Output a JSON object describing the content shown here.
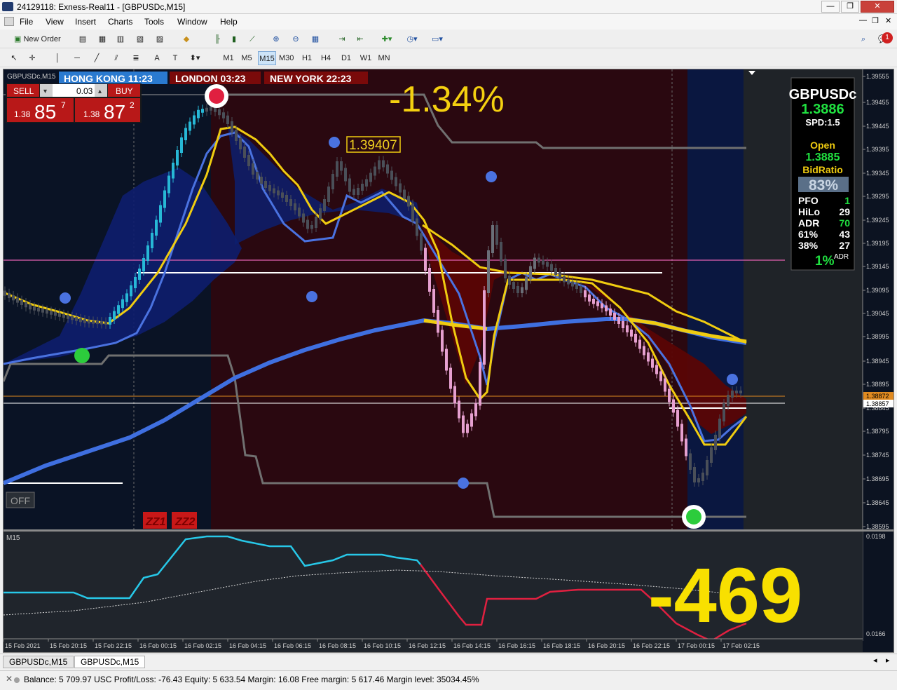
{
  "window": {
    "title": "24129118: Exness-Real11 - [GBPUSDc,M15]",
    "min": "—",
    "restore": "❐",
    "close": "✕"
  },
  "menu": [
    "File",
    "View",
    "Insert",
    "Charts",
    "Tools",
    "Window",
    "Help"
  ],
  "toolbar": {
    "new_order": "New Order",
    "notification_count": "1"
  },
  "timeframes": [
    "M1",
    "M5",
    "M15",
    "M30",
    "H1",
    "H4",
    "D1",
    "W1",
    "MN"
  ],
  "chart": {
    "symbol_label": "GBPUSDc,M15",
    "sessions": {
      "hong_kong": "HONG KONG 11:23",
      "london": "LONDON  03:23",
      "new_york": "NEW YORK 22:23"
    },
    "trade": {
      "sell": "SELL",
      "buy": "BUY",
      "lot": "0.03",
      "sell_small": "1.38",
      "sell_big": "85",
      "sell_sup": "7",
      "buy_small": "1.38",
      "buy_big": "87",
      "buy_sup": "2"
    },
    "percent_change": "-1.34%",
    "high_label": "1.39407",
    "off_button": "OFF",
    "zz1": "ZZ1",
    "zz2": "ZZ2",
    "price_axis": [
      "1.39555",
      "1.39455",
      "1.39445",
      "1.39395",
      "1.39345",
      "1.39295",
      "1.39245",
      "1.39195",
      "1.39145",
      "1.39095",
      "1.39045",
      "1.38995",
      "1.38945",
      "1.38895",
      "1.38845",
      "1.38795",
      "1.38745",
      "1.38695",
      "1.38645",
      "1.38595"
    ],
    "price_tags": [
      "1.38872",
      "1.38857"
    ],
    "panel": {
      "symbol": "GBPUSDc",
      "price": "1.3886",
      "spread": "SPD:1.5",
      "open_label": "Open",
      "open_value": "1.3885",
      "bid_label": "BidRatio",
      "bid_value": "83%",
      "stats": [
        {
          "k": "PFO",
          "v": "1"
        },
        {
          "k": "HiLo",
          "v": "29"
        },
        {
          "k": "ADR",
          "v": "70"
        },
        {
          "k": "61%",
          "v": "43"
        },
        {
          "k": "38%",
          "v": "27"
        }
      ],
      "adr_pct": "1%",
      "adr_sup": "ADR"
    },
    "time_axis": [
      "15 Feb 2021",
      "15 Feb 20:15",
      "15 Feb 22:15",
      "16 Feb 00:15",
      "16 Feb 02:15",
      "16 Feb 04:15",
      "16 Feb 06:15",
      "16 Feb 08:15",
      "16 Feb 10:15",
      "16 Feb 12:15",
      "16 Feb 14:15",
      "16 Feb 16:15",
      "16 Feb 18:15",
      "16 Feb 20:15",
      "16 Feb 22:15",
      "17 Feb 00:15",
      "17 Feb 02:15"
    ],
    "sub": {
      "label": "M15",
      "top": "0.0198",
      "bottom": "0.0166",
      "big_value": "-469"
    },
    "colors": {
      "bg": "#0c1321",
      "bull": "#27b8d6",
      "bear": "#e6a0d0",
      "yellow": "#f0cc10",
      "blue": "#3f6fe0",
      "maroon": "#5a0505",
      "navy": "#0a1850"
    }
  },
  "tabs": [
    "GBPUSDc,M15",
    "GBPUSDc,M15"
  ],
  "status": "Balance: 5 709.97 USC  Profit/Loss: -76.43  Equity: 5 633.54  Margin: 16.08  Free margin: 5 617.46  Margin level: 35034.45%"
}
